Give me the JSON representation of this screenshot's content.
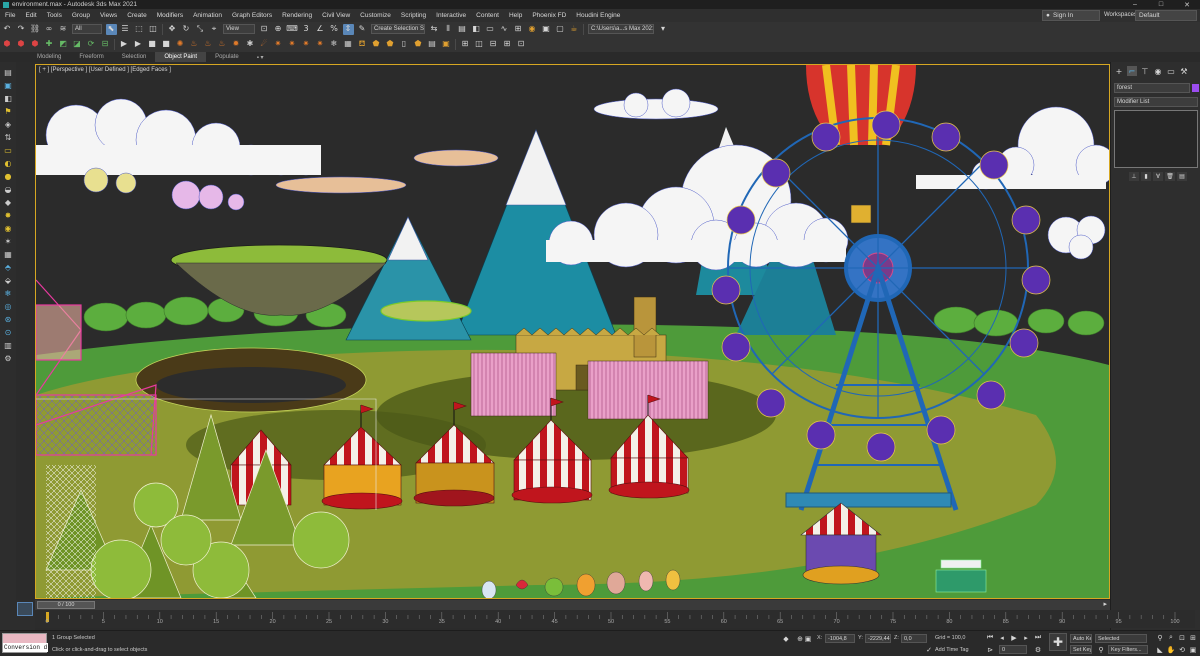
{
  "app": {
    "title": "environment.max - Autodesk 3ds Max 2021"
  },
  "menu": [
    "File",
    "Edit",
    "Tools",
    "Group",
    "Views",
    "Create",
    "Modifiers",
    "Animation",
    "Graph Editors",
    "Rendering",
    "Civil View",
    "Customize",
    "Scripting",
    "Interactive",
    "Content",
    "Help",
    "Phoenix FD",
    "Houdini Engine"
  ],
  "account": {
    "sign_in": "Sign In",
    "workspaces_label": "Workspaces:",
    "workspace_value": "Default"
  },
  "toolbar": {
    "selection_filter": "All",
    "ref_coord": "View",
    "named_selection": "Create Selection Se",
    "project_path": "C:\\Users\\a...s Max 2021"
  },
  "ribbon": {
    "tabs": [
      "Modeling",
      "Freeform",
      "Selection",
      "Object Paint",
      "Populate"
    ],
    "active": "Object Paint"
  },
  "viewport": {
    "label": "[ + ] [Perspective ] [User Defined ] [Edged Faces ]"
  },
  "command_panel": {
    "object_name": "forest",
    "modifier_list": "Modifier List",
    "color": "#9b4df0"
  },
  "timeline": {
    "slider_label": "0 / 100",
    "ticks": [
      "0",
      "5",
      "10",
      "15",
      "20",
      "25",
      "30",
      "35",
      "40",
      "45",
      "50",
      "55",
      "60",
      "65",
      "70",
      "75",
      "80",
      "85",
      "90",
      "95",
      "100"
    ]
  },
  "status": {
    "listener": "Conversion d",
    "selection": "1 Group Selected",
    "prompt": "Click or click-and-drag to select objects",
    "x_label": "X:",
    "y_label": "Y:",
    "z_label": "Z:",
    "x_value": "-1004,8",
    "y_value": "-2229,44",
    "z_value": "0,0",
    "grid": "Grid = 100,0",
    "add_time_tag": "Add Time Tag",
    "auto_key": "Auto Key",
    "set_key": "Set Key",
    "key_mode": "Selected",
    "key_filters": "Key Filters...",
    "frame": "0"
  },
  "colors": {
    "accent": "#5a87b8",
    "viewport_border": "#d6a722",
    "ground": "#8f9a33",
    "sky": "#2c2c2c"
  }
}
